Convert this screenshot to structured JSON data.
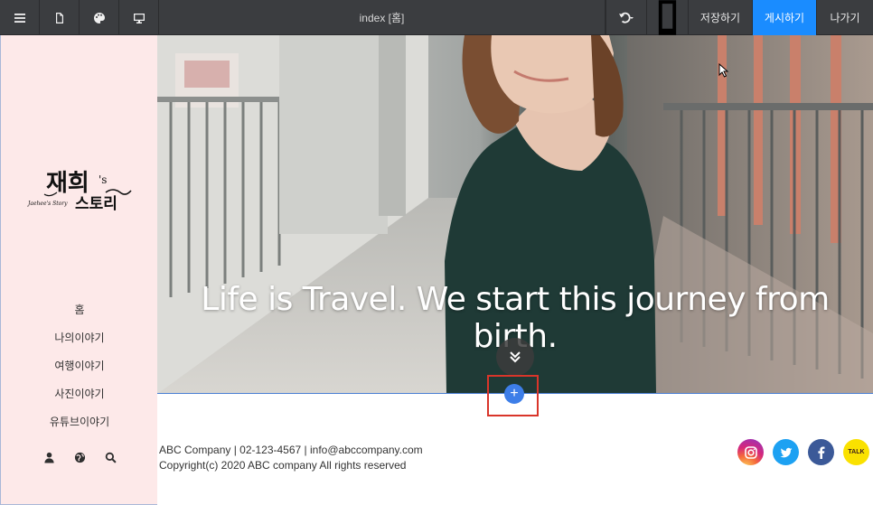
{
  "toolbar": {
    "title": "index [홈]",
    "save_label": "저장하기",
    "publish_label": "게시하기",
    "exit_label": "나가기",
    "icons": [
      "menu-icon",
      "page-icon",
      "palette-icon",
      "desktop-icon",
      "undo-icon",
      "mobile-icon"
    ]
  },
  "sidebar": {
    "logo_text": "재희's 스토리",
    "nav_items": [
      {
        "label": "홈"
      },
      {
        "label": "나의이야기"
      },
      {
        "label": "여행이야기"
      },
      {
        "label": "사진이야기"
      },
      {
        "label": "유튜브이야기"
      }
    ],
    "icons": [
      "user-icon",
      "globe-icon",
      "search-icon"
    ]
  },
  "hero": {
    "headline": "Life is Travel. We start this journey from birth."
  },
  "footer": {
    "contact_line": "ABC Company | 02-123-4567 | info@abccompany.com",
    "copyright_line": "Copyright(c) 2020 ABC company All rights reserved",
    "socials": [
      "instagram-icon",
      "twitter-icon",
      "facebook-icon",
      "kakaotalk-icon"
    ],
    "kakao_label": "TALK"
  },
  "colors": {
    "toolbar_bg": "#3b3d40",
    "publish_accent": "#1a8cff",
    "sidebar_bg": "#fde9e9",
    "add_button": "#3d7ee8",
    "highlight_border": "#d9352a"
  }
}
